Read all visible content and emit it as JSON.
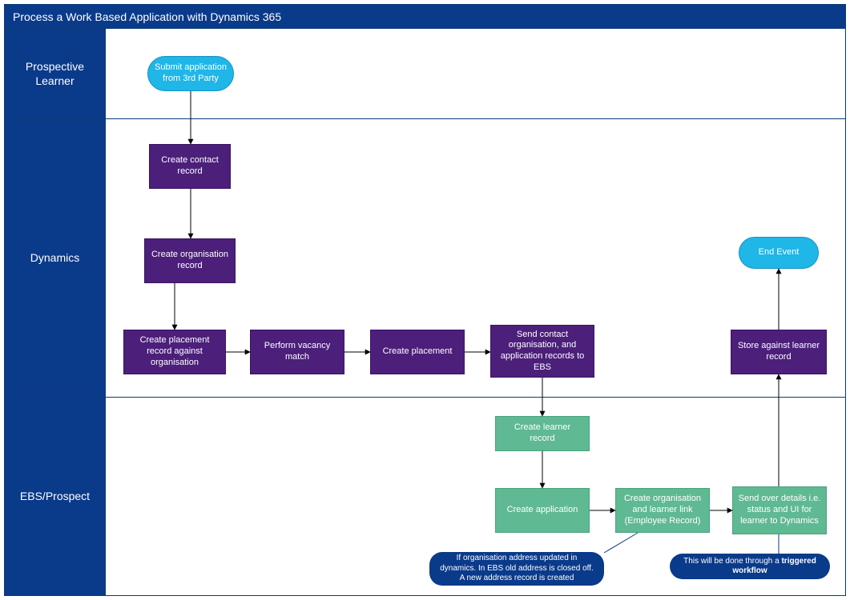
{
  "title": "Process a Work Based Application with Dynamics 365",
  "lanes": {
    "prospective": "Prospective Learner",
    "dynamics": "Dynamics",
    "ebs": "EBS/Prospect"
  },
  "nodes": {
    "submit": "Submit application from 3rd Party",
    "create_contact": "Create contact record",
    "create_org": "Create organisation record",
    "create_placement_record": "Create placement record against organisation",
    "vacancy": "Perform vacancy match",
    "create_placement": "Create placement",
    "send_to_ebs": "Send contact organisation, and application records to EBS",
    "end_event": "End Event",
    "store_learner": "Store against learner record",
    "create_learner": "Create learner record",
    "create_application": "Create application",
    "create_link": "Create organisation and learner link (Employee Record)",
    "send_details": "Send over details i.e. status and UI for learner to Dynamics"
  },
  "notes": {
    "address_note": "If organisation address updated in dynamics. In EBS old address is closed off. A new address record is created",
    "workflow_note_prefix": "This will be done through a ",
    "workflow_note_bold": "triggered workflow"
  }
}
